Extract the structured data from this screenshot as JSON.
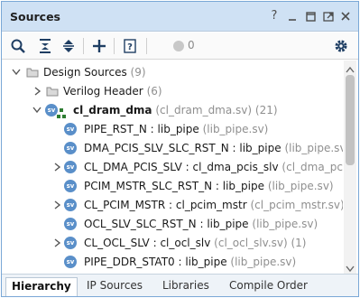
{
  "panel": {
    "title": "Sources",
    "controls": {
      "help": "?"
    }
  },
  "toolbar": {
    "count": "0"
  },
  "tree": {
    "root": {
      "label": "Design Sources",
      "count": "(9)"
    },
    "verilog_header": {
      "label": "Verilog Header",
      "count": "(6)"
    },
    "top": {
      "label": "cl_dram_dma",
      "file": "(cl_dram_dma.sv)",
      "count": "(21)"
    },
    "items": [
      {
        "label": "PIPE_RST_N : lib_pipe",
        "file": "(lib_pipe.sv)"
      },
      {
        "label": "DMA_PCIS_SLV_SLC_RST_N : lib_pipe",
        "file": "(lib_pipe.sv)"
      },
      {
        "label": "CL_DMA_PCIS_SLV : cl_dma_pcis_slv",
        "file": "(cl_dma_pcis_"
      },
      {
        "label": "PCIM_MSTR_SLC_RST_N : lib_pipe",
        "file": "(lib_pipe.sv)"
      },
      {
        "label": "CL_PCIM_MSTR : cl_pcim_mstr",
        "file": "(cl_pcim_mstr.sv) (2"
      },
      {
        "label": "OCL_SLV_SLC_RST_N : lib_pipe",
        "file": "(lib_pipe.sv)"
      },
      {
        "label": "CL_OCL_SLV : cl_ocl_slv",
        "file": "(cl_ocl_slv.sv) (1)"
      },
      {
        "label": "PIPE_DDR_STAT0 : lib_pipe",
        "file": "(lib_pipe.sv)"
      }
    ],
    "badge": "sv"
  },
  "tabs": [
    "Hierarchy",
    "IP Sources",
    "Libraries",
    "Compile Order"
  ],
  "colors": {
    "title_bg": "#cfe1f4",
    "border": "#7aa7d6",
    "sv_badge": "#5a8fc9"
  }
}
